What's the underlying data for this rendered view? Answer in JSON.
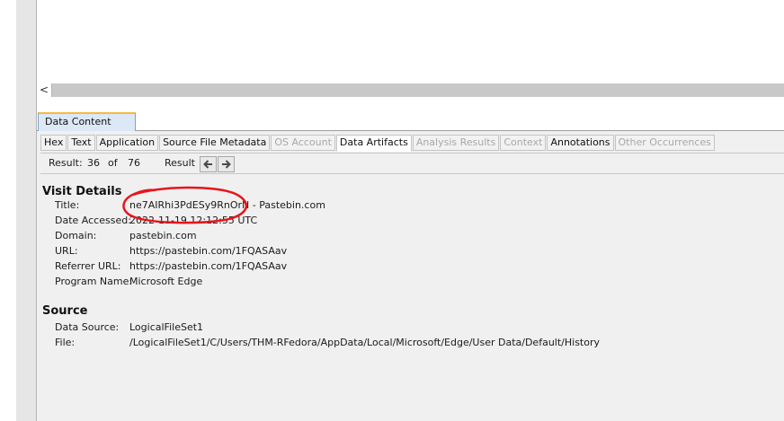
{
  "top_pane": {
    "scroll_left_glyph": "<"
  },
  "outer_tab": {
    "label": "Data Content"
  },
  "subtabs": [
    {
      "label": "Hex",
      "enabled": true
    },
    {
      "label": "Text",
      "enabled": true
    },
    {
      "label": "Application",
      "enabled": true
    },
    {
      "label": "Source File Metadata",
      "enabled": true
    },
    {
      "label": "OS Account",
      "enabled": false
    },
    {
      "label": "Data Artifacts",
      "enabled": true,
      "active": true
    },
    {
      "label": "Analysis Results",
      "enabled": false
    },
    {
      "label": "Context",
      "enabled": false
    },
    {
      "label": "Annotations",
      "enabled": true
    },
    {
      "label": "Other Occurrences",
      "enabled": false
    }
  ],
  "toolbar": {
    "result_label": "Result:",
    "current": "36",
    "of_label": "of",
    "total": "76",
    "result_nav_label": "Result",
    "prev_icon": "arrow-left-icon",
    "next_icon": "arrow-right-icon"
  },
  "visit_details": {
    "title": "Visit Details",
    "rows": [
      {
        "label": "Title:",
        "value": "ne7AIRhi3PdESy9RnOrN - Pastebin.com"
      },
      {
        "label": "Date Accessed:",
        "value": "2022-11-19 12:12:55 UTC"
      },
      {
        "label": "Domain:",
        "value": "pastebin.com"
      },
      {
        "label": "URL:",
        "value": "https://pastebin.com/1FQASAav"
      },
      {
        "label": "Referrer URL:",
        "value": "https://pastebin.com/1FQASAav"
      },
      {
        "label": "Program Name:",
        "value": "Microsoft Edge"
      }
    ]
  },
  "source": {
    "title": "Source",
    "rows": [
      {
        "label": "Data Source:",
        "value": "LogicalFileSet1"
      },
      {
        "label": "File:",
        "value": "/LogicalFileSet1/C/Users/THM-RFedora/AppData/Local/Microsoft/Edge/User Data/Default/History"
      }
    ]
  },
  "colors": {
    "annotation": "#e8141b",
    "tab_accent": "#f7b940",
    "panel_bg": "#f0f0f0"
  }
}
